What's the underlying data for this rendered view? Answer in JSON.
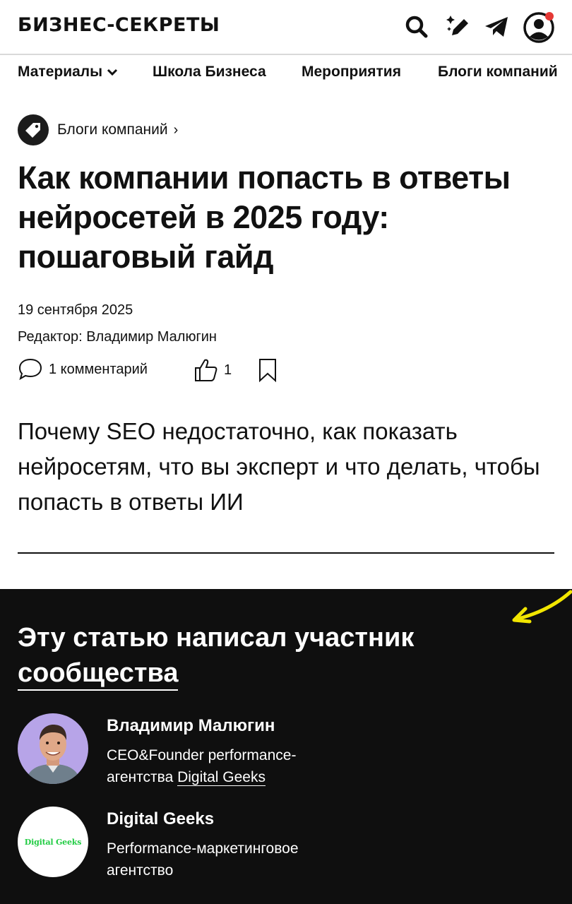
{
  "header": {
    "logo": "БИЗНЕС-СЕКРЕТЫ",
    "icons": [
      "search-icon",
      "pen-sparkle-icon",
      "telegram-icon",
      "profile-icon"
    ],
    "notification_color": "#e53935"
  },
  "nav": {
    "items": [
      {
        "label": "Материалы",
        "has_dropdown": true
      },
      {
        "label": "Школа Бизнеса"
      },
      {
        "label": "Мероприятия"
      },
      {
        "label": "Блоги компаний"
      }
    ]
  },
  "breadcrumb": {
    "label": "Блоги компаний",
    "chevron": "›"
  },
  "article": {
    "title": "Как компании попасть в ответы нейросетей в 2025 году: пошаговый гайд",
    "date": "19 сентября 2025",
    "editor": "Редактор: Владимир Малюгин",
    "comments": "1 комментарий",
    "likes": "1",
    "lead": "Почему SEO недостаточно, как показать нейросетям, что вы эксперт и что делать, чтобы попасть в ответы ИИ"
  },
  "author_section": {
    "title_line1": "Эту статью написал участник",
    "title_line2": "сообщества",
    "accent_color": "#f2e600",
    "person": {
      "name": "Владимир Малюгин",
      "desc_line1": "CEO&Founder performance-",
      "desc_prefix": "агентства ",
      "desc_link": "Digital Geeks"
    },
    "company": {
      "name": "Digital Geeks",
      "logo_text": "Digital Geeks",
      "desc_line1": "Performance-маркетинговое",
      "desc_line2": "агентство"
    }
  }
}
